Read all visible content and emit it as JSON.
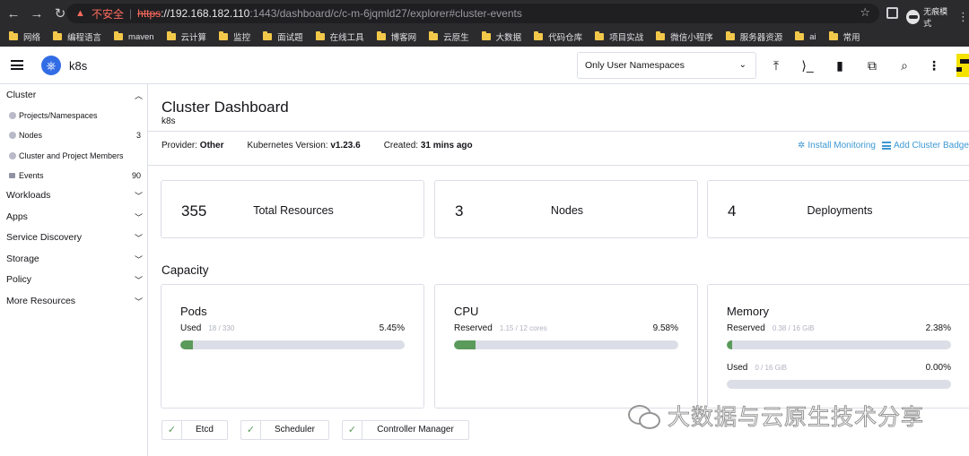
{
  "browser": {
    "security_label": "不安全",
    "url_scheme": "https",
    "url_host": "://192.168.182.110",
    "url_rest": ":1443/dashboard/c/c-m-6jqmld27/explorer#cluster-events",
    "incognito_label": "无痕模式",
    "bookmarks": [
      "网络",
      "编程语言",
      "maven",
      "云计算",
      "监控",
      "面试题",
      "在线工具",
      "博客网",
      "云原生",
      "大数据",
      "代码仓库",
      "项目实战",
      "微信小程序",
      "服务器资源",
      "ai",
      "常用"
    ]
  },
  "header": {
    "cluster_name": "k8s",
    "namespace_filter": "Only User Namespaces"
  },
  "sidebar": {
    "cluster_group": "Cluster",
    "items": [
      {
        "label": "Projects/Namespaces",
        "count": ""
      },
      {
        "label": "Nodes",
        "count": "3"
      },
      {
        "label": "Cluster and Project Members",
        "count": ""
      },
      {
        "label": "Events",
        "count": "90"
      }
    ],
    "groups": [
      "Workloads",
      "Apps",
      "Service Discovery",
      "Storage",
      "Policy",
      "More Resources"
    ]
  },
  "main": {
    "title": "Cluster Dashboard",
    "subtitle": "k8s",
    "provider_label": "Provider:",
    "provider_value": "Other",
    "k8s_label": "Kubernetes Version:",
    "k8s_value": "v1.23.6",
    "created_label": "Created:",
    "created_value": "31 mins ago",
    "install_monitoring": "Install Monitoring",
    "add_badge": "Add Cluster Badge",
    "counts": [
      {
        "value": "355",
        "label": "Total Resources"
      },
      {
        "value": "3",
        "label": "Nodes"
      },
      {
        "value": "4",
        "label": "Deployments"
      }
    ],
    "capacity_title": "Capacity",
    "capacity": [
      {
        "name": "Pods",
        "rows": [
          {
            "label": "Used",
            "detail": "18 / 330",
            "pct": "5.45%",
            "fraction": 0.0545
          }
        ]
      },
      {
        "name": "CPU",
        "rows": [
          {
            "label": "Reserved",
            "detail": "1.15 / 12 cores",
            "pct": "9.58%",
            "fraction": 0.0958
          }
        ]
      },
      {
        "name": "Memory",
        "rows": [
          {
            "label": "Reserved",
            "detail": "0.38 / 16 GiB",
            "pct": "2.38%",
            "fraction": 0.0238
          },
          {
            "label": "Used",
            "detail": "0 / 16 GiB",
            "pct": "0.00%",
            "fraction": 0.0
          }
        ]
      }
    ],
    "components": [
      "Etcd",
      "Scheduler",
      "Controller Manager"
    ]
  },
  "watermark": "大数据与云原生技术分享",
  "colors": {
    "accent_link": "#3d98d3",
    "progress_fill": "#5a9a5a",
    "k8s_blue": "#326ce5"
  }
}
